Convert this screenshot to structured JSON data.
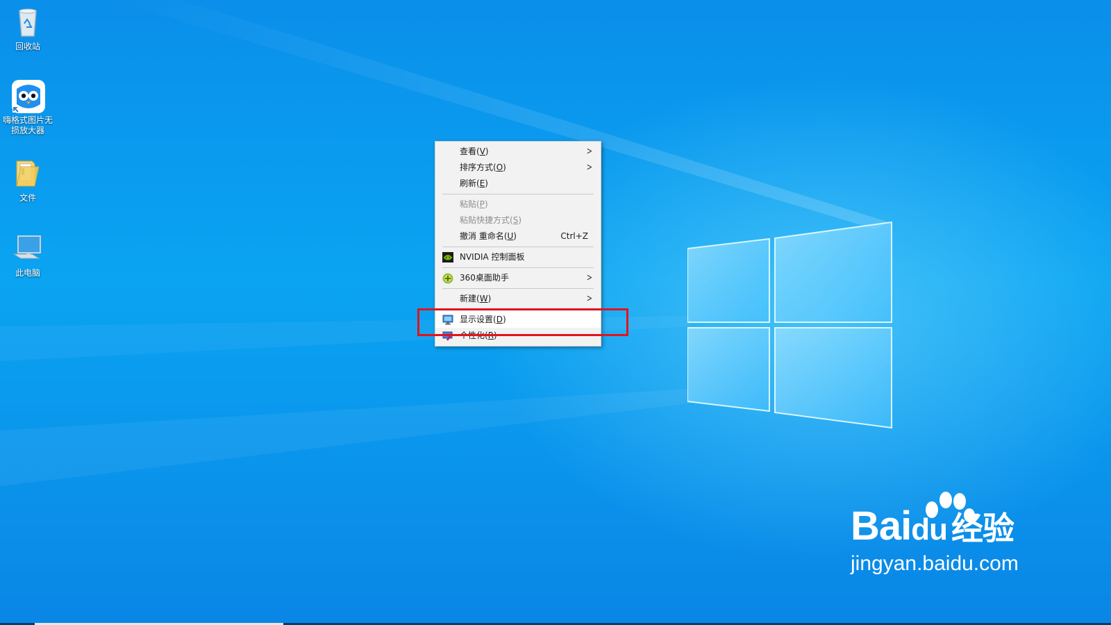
{
  "desktop_icons": [
    {
      "label": "回收站",
      "icon": "recycle-bin-icon"
    },
    {
      "label": "嗨格式图片无损放大器",
      "icon": "owl-app-icon"
    },
    {
      "label": "文件",
      "icon": "folder-icon"
    },
    {
      "label": "此电脑",
      "icon": "computer-icon"
    }
  ],
  "menu": {
    "view": {
      "text": "查看(",
      "key": "V",
      "close": ")"
    },
    "sort": {
      "text": "排序方式(",
      "key": "O",
      "close": ")"
    },
    "refresh": {
      "text": "刷新(",
      "key": "E",
      "close": ")"
    },
    "paste": {
      "text": "粘贴(",
      "key": "P",
      "close": ")"
    },
    "paste_shortcut": {
      "text": "粘贴快捷方式(",
      "key": "S",
      "close": ")"
    },
    "undo": {
      "text": "撤消 重命名(",
      "key": "U",
      "close": ")",
      "shortcut": "Ctrl+Z"
    },
    "nvidia": {
      "text": "NVIDIA 控制面板",
      "icon": "nvidia-icon"
    },
    "assistant360": {
      "text": "360桌面助手",
      "icon": "360-icon"
    },
    "new": {
      "text": "新建(",
      "key": "W",
      "close": ")"
    },
    "display": {
      "text": "显示设置(",
      "key": "D",
      "close": ")",
      "icon": "display-settings-icon"
    },
    "personalize": {
      "text": "个性化(",
      "key": "R",
      "close": ")",
      "icon": "personalize-icon"
    }
  },
  "highlight_color": "#e0141c",
  "watermark": {
    "line1_prefix": "Bai",
    "line1_mid": "du",
    "line1_suffix": "经验",
    "line2": "jingyan.baidu.com"
  }
}
